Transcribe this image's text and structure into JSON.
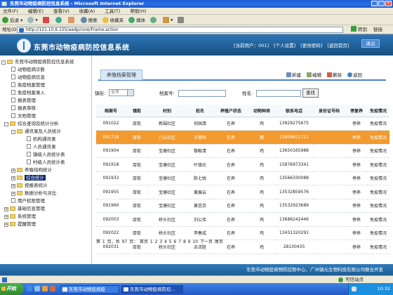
{
  "window": {
    "title": "东莞市动物疫病防控信息系统 - Microsoft Internet Explorer"
  },
  "menu": [
    "文件(F)",
    "编辑(E)",
    "查看(V)",
    "收藏(A)",
    "工具(T)",
    "帮助(H)"
  ],
  "toolbar": {
    "back": "后退",
    "search": "搜索",
    "favorites": "收藏夹",
    "media": "媒体"
  },
  "address": {
    "label": "地址(D)",
    "url": "http://121.10.6.155/aadp/core/Frame.action",
    "go": "转到",
    "links": "链接"
  },
  "header": {
    "system_title": "东莞市动物疫病防控信息系统",
    "current_user": "[当前用户：001]",
    "personal_settings": "[个人设置]",
    "change_password": "[更改密码]",
    "back_home": "[返回首页]",
    "exit": "退出"
  },
  "sidebar": {
    "root": "东莞市动物疫病防控信息系统",
    "items": [
      {
        "label": "动物疫病诊断",
        "type": "doc"
      },
      {
        "label": "动物疫病信息",
        "type": "doc"
      },
      {
        "label": "免疫档案管理",
        "type": "doc"
      },
      {
        "label": "免疫档案录入",
        "type": "doc"
      },
      {
        "label": "报表管理",
        "type": "doc"
      },
      {
        "label": "报表审核",
        "type": "doc"
      },
      {
        "label": "文档管理",
        "type": "doc"
      },
      {
        "label": "综合查询及统计分析",
        "type": "folder"
      },
      {
        "label": "通讯录及人员统计",
        "type": "folder"
      },
      {
        "label": "机构通讯录",
        "type": "doc"
      },
      {
        "label": "人员通讯录",
        "type": "doc"
      },
      {
        "label": "镇级人员统计表",
        "type": "doc"
      },
      {
        "label": "村级人员统计表",
        "type": "doc"
      },
      {
        "label": "养殖结构统计",
        "type": "folder"
      },
      {
        "label": "综合统计",
        "type": "folder"
      },
      {
        "label": "按报表统计",
        "type": "folder"
      },
      {
        "label": "数据分析与对比",
        "type": "folder"
      },
      {
        "label": "用户权限管理",
        "type": "doc"
      },
      {
        "label": "基础信息管理",
        "type": "folder"
      },
      {
        "label": "系统管理",
        "type": "folder"
      },
      {
        "label": "提醒管理",
        "type": "folder"
      }
    ]
  },
  "page": {
    "title": "养殖档案管理",
    "actions": {
      "new": "新建",
      "edit": "编辑",
      "delete": "删除",
      "back": "返回"
    }
  },
  "search": {
    "town_label": "镇街:",
    "town_value": "全市",
    "archive_label": "档案号:",
    "archive_value": "",
    "name_label": "姓名:",
    "name_value": "",
    "query_button": "查找"
  },
  "table": {
    "headers": [
      "档案号",
      "镇街",
      "村别",
      "姓名",
      "养殖户状态",
      "动物种类",
      "联系电话",
      "身份证号码",
      "停复养",
      "免疫情况"
    ],
    "rows": [
      [
        "091022",
        "厚街",
        "新围社区",
        "何国清",
        "在养",
        "鸡",
        "13929275675",
        "",
        "停养",
        "免疫情况"
      ],
      [
        "091718",
        "厚街",
        "汀山社区",
        "王德祥",
        "在养",
        "猪",
        "13809621721",
        "",
        "停养",
        "免疫情况"
      ],
      [
        "091904",
        "厚街",
        "宝塘社区",
        "黎献清",
        "在养",
        "鸡",
        "13650165988",
        "",
        "停养",
        "免疫情况"
      ],
      [
        "091918",
        "厚街",
        "宝塘社区",
        "叶镇光",
        "在养",
        "鸡",
        "15876973341",
        "",
        "停养",
        "免疫情况"
      ],
      [
        "091933",
        "厚街",
        "宝塘社区",
        "陈七锐",
        "在养",
        "鸡",
        "13566330088",
        "",
        "停养",
        "免疫情况"
      ],
      [
        "091955",
        "厚街",
        "宝塘社区",
        "黄展云",
        "在养",
        "鸡",
        "13532859576",
        "",
        "停养",
        "免疫情况"
      ],
      [
        "091960",
        "厚街",
        "宝塘社区",
        "黄信京",
        "在养",
        "鸡",
        "13532923689",
        "",
        "停养",
        "免疫情况"
      ],
      [
        "092003",
        "厚街",
        "桥头社区",
        "刘公伟",
        "在养",
        "鸡",
        "13686242446",
        "",
        "停养",
        "免疫情况"
      ],
      [
        "092022",
        "厚街",
        "桥头社区",
        "李春成",
        "在养",
        "鸡",
        "13431320291",
        "",
        "停养",
        "免疫情况"
      ],
      [
        "092031",
        "厚街",
        "桥头社区",
        "余活胜",
        "在养",
        "鸡",
        "28130435",
        "",
        "停养",
        "免疫情况"
      ]
    ],
    "highlighted_row": 1
  },
  "pager": {
    "text": "第 1 页，共 97 页：    首页  1 2 3 4 5 6 7 8 9 10  下一页  尾页"
  },
  "footer": {
    "text": "东莞市动物疫病预防控制中心、广州镇元生物科技有限公司联合开发"
  },
  "statusbar": {
    "zone": "可信站点"
  },
  "taskbar": {
    "start": "开始",
    "tasks": [
      "东莞市动物疫病疫",
      "东莞市动物疫病防控..."
    ],
    "clock": "10:32"
  },
  "colors": {
    "header_blue": "#17507f",
    "row_highlight": "#f29a2e",
    "accent": "#4a84c0"
  }
}
